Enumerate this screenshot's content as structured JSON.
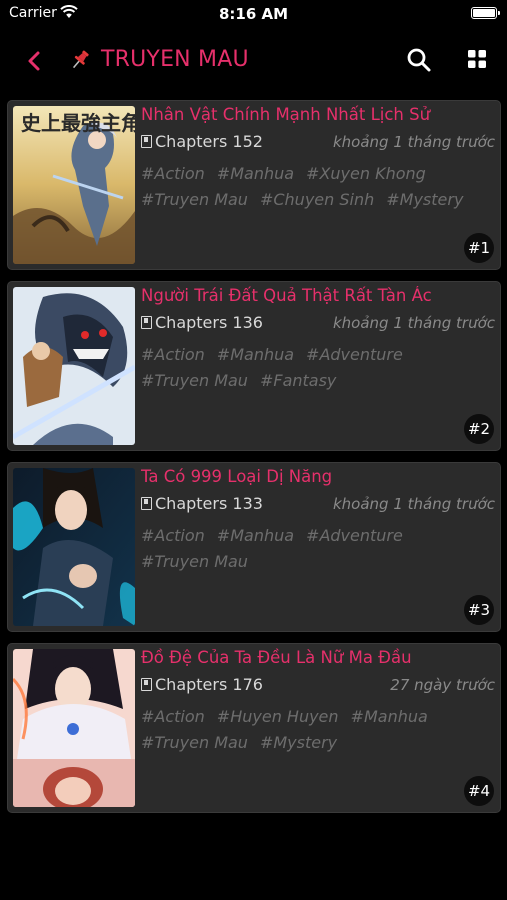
{
  "status_bar": {
    "carrier": "Carrier",
    "time": "8:16 AM"
  },
  "nav": {
    "title": "TRUYEN MAU",
    "accent_color": "#e6306b",
    "icons": [
      "back-chevron-icon",
      "pin-icon",
      "search-icon",
      "grid-icon"
    ]
  },
  "stories": [
    {
      "title": "Nhân Vật Chính Mạnh Nhất Lịch Sử",
      "chapters": "Chapters 152",
      "updated": "khoảng 1 tháng trước",
      "tags": [
        "#Action",
        "#Manhua",
        "#Xuyen Khong",
        "#Truyen Mau",
        "#Chuyen Sinh",
        "#Mystery"
      ],
      "rank": "#1"
    },
    {
      "title": "Người Trái Đất Quả Thật Rất Tàn Ác",
      "chapters": "Chapters 136",
      "updated": "khoảng 1 tháng trước",
      "tags": [
        "#Action",
        "#Manhua",
        "#Adventure",
        "#Truyen Mau",
        "#Fantasy"
      ],
      "rank": "#2"
    },
    {
      "title": "Ta Có 999 Loại Dị Năng",
      "chapters": "Chapters 133",
      "updated": "khoảng 1 tháng trước",
      "tags": [
        "#Action",
        "#Manhua",
        "#Adventure",
        "#Truyen Mau"
      ],
      "rank": "#3"
    },
    {
      "title": "Đồ Đệ Của Ta Đều Là Nữ Ma Đầu",
      "chapters": "Chapters 176",
      "updated": "27 ngày trước",
      "tags": [
        "#Action",
        "#Huyen Huyen",
        "#Manhua",
        "#Truyen Mau",
        "#Mystery"
      ],
      "rank": "#4"
    }
  ],
  "cover_title_text": "史上最強主角"
}
